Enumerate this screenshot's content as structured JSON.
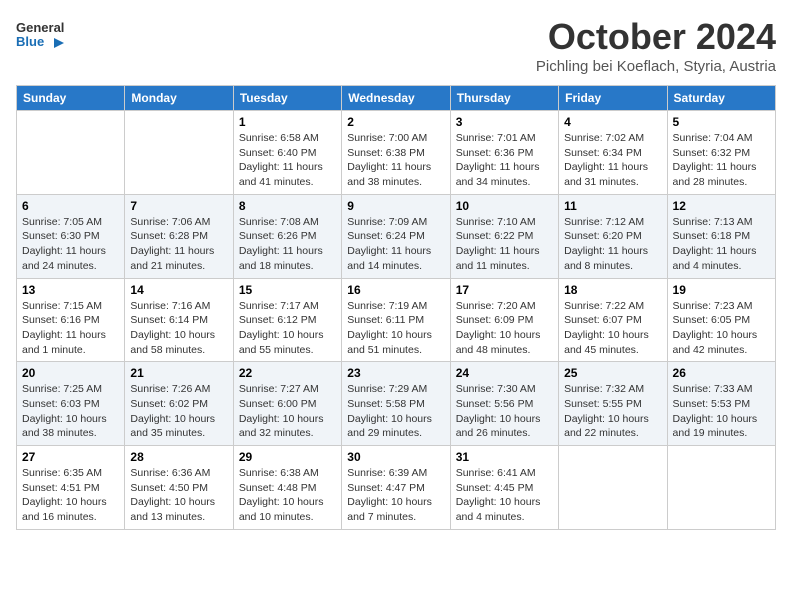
{
  "header": {
    "logo_general": "General",
    "logo_blue": "Blue",
    "month_title": "October 2024",
    "location": "Pichling bei Koeflach, Styria, Austria"
  },
  "days_of_week": [
    "Sunday",
    "Monday",
    "Tuesday",
    "Wednesday",
    "Thursday",
    "Friday",
    "Saturday"
  ],
  "weeks": [
    [
      {
        "day": "",
        "info": ""
      },
      {
        "day": "",
        "info": ""
      },
      {
        "day": "1",
        "info": "Sunrise: 6:58 AM\nSunset: 6:40 PM\nDaylight: 11 hours and 41 minutes."
      },
      {
        "day": "2",
        "info": "Sunrise: 7:00 AM\nSunset: 6:38 PM\nDaylight: 11 hours and 38 minutes."
      },
      {
        "day": "3",
        "info": "Sunrise: 7:01 AM\nSunset: 6:36 PM\nDaylight: 11 hours and 34 minutes."
      },
      {
        "day": "4",
        "info": "Sunrise: 7:02 AM\nSunset: 6:34 PM\nDaylight: 11 hours and 31 minutes."
      },
      {
        "day": "5",
        "info": "Sunrise: 7:04 AM\nSunset: 6:32 PM\nDaylight: 11 hours and 28 minutes."
      }
    ],
    [
      {
        "day": "6",
        "info": "Sunrise: 7:05 AM\nSunset: 6:30 PM\nDaylight: 11 hours and 24 minutes."
      },
      {
        "day": "7",
        "info": "Sunrise: 7:06 AM\nSunset: 6:28 PM\nDaylight: 11 hours and 21 minutes."
      },
      {
        "day": "8",
        "info": "Sunrise: 7:08 AM\nSunset: 6:26 PM\nDaylight: 11 hours and 18 minutes."
      },
      {
        "day": "9",
        "info": "Sunrise: 7:09 AM\nSunset: 6:24 PM\nDaylight: 11 hours and 14 minutes."
      },
      {
        "day": "10",
        "info": "Sunrise: 7:10 AM\nSunset: 6:22 PM\nDaylight: 11 hours and 11 minutes."
      },
      {
        "day": "11",
        "info": "Sunrise: 7:12 AM\nSunset: 6:20 PM\nDaylight: 11 hours and 8 minutes."
      },
      {
        "day": "12",
        "info": "Sunrise: 7:13 AM\nSunset: 6:18 PM\nDaylight: 11 hours and 4 minutes."
      }
    ],
    [
      {
        "day": "13",
        "info": "Sunrise: 7:15 AM\nSunset: 6:16 PM\nDaylight: 11 hours and 1 minute."
      },
      {
        "day": "14",
        "info": "Sunrise: 7:16 AM\nSunset: 6:14 PM\nDaylight: 10 hours and 58 minutes."
      },
      {
        "day": "15",
        "info": "Sunrise: 7:17 AM\nSunset: 6:12 PM\nDaylight: 10 hours and 55 minutes."
      },
      {
        "day": "16",
        "info": "Sunrise: 7:19 AM\nSunset: 6:11 PM\nDaylight: 10 hours and 51 minutes."
      },
      {
        "day": "17",
        "info": "Sunrise: 7:20 AM\nSunset: 6:09 PM\nDaylight: 10 hours and 48 minutes."
      },
      {
        "day": "18",
        "info": "Sunrise: 7:22 AM\nSunset: 6:07 PM\nDaylight: 10 hours and 45 minutes."
      },
      {
        "day": "19",
        "info": "Sunrise: 7:23 AM\nSunset: 6:05 PM\nDaylight: 10 hours and 42 minutes."
      }
    ],
    [
      {
        "day": "20",
        "info": "Sunrise: 7:25 AM\nSunset: 6:03 PM\nDaylight: 10 hours and 38 minutes."
      },
      {
        "day": "21",
        "info": "Sunrise: 7:26 AM\nSunset: 6:02 PM\nDaylight: 10 hours and 35 minutes."
      },
      {
        "day": "22",
        "info": "Sunrise: 7:27 AM\nSunset: 6:00 PM\nDaylight: 10 hours and 32 minutes."
      },
      {
        "day": "23",
        "info": "Sunrise: 7:29 AM\nSunset: 5:58 PM\nDaylight: 10 hours and 29 minutes."
      },
      {
        "day": "24",
        "info": "Sunrise: 7:30 AM\nSunset: 5:56 PM\nDaylight: 10 hours and 26 minutes."
      },
      {
        "day": "25",
        "info": "Sunrise: 7:32 AM\nSunset: 5:55 PM\nDaylight: 10 hours and 22 minutes."
      },
      {
        "day": "26",
        "info": "Sunrise: 7:33 AM\nSunset: 5:53 PM\nDaylight: 10 hours and 19 minutes."
      }
    ],
    [
      {
        "day": "27",
        "info": "Sunrise: 6:35 AM\nSunset: 4:51 PM\nDaylight: 10 hours and 16 minutes."
      },
      {
        "day": "28",
        "info": "Sunrise: 6:36 AM\nSunset: 4:50 PM\nDaylight: 10 hours and 13 minutes."
      },
      {
        "day": "29",
        "info": "Sunrise: 6:38 AM\nSunset: 4:48 PM\nDaylight: 10 hours and 10 minutes."
      },
      {
        "day": "30",
        "info": "Sunrise: 6:39 AM\nSunset: 4:47 PM\nDaylight: 10 hours and 7 minutes."
      },
      {
        "day": "31",
        "info": "Sunrise: 6:41 AM\nSunset: 4:45 PM\nDaylight: 10 hours and 4 minutes."
      },
      {
        "day": "",
        "info": ""
      },
      {
        "day": "",
        "info": ""
      }
    ]
  ]
}
